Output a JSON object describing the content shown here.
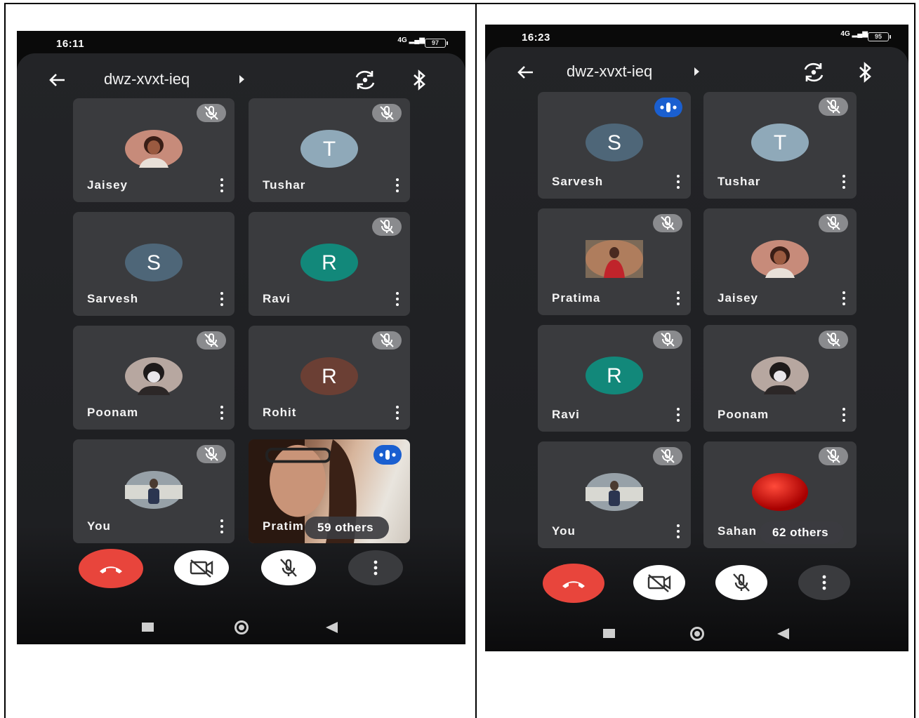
{
  "left_phone": {
    "status": {
      "time": "16:11",
      "network": "4G",
      "battery": "97"
    },
    "header": {
      "meeting_code": "dwz-xvxt-ieq"
    },
    "tiles": [
      {
        "name": "Jaisey",
        "initial": "",
        "avatar_color": "#c78b7a",
        "photo": "woman-avatar",
        "badge": "muted"
      },
      {
        "name": "Tushar",
        "initial": "T",
        "avatar_color": "#8fa9b9",
        "photo": "",
        "badge": "muted"
      },
      {
        "name": "Sarvesh",
        "initial": "S",
        "avatar_color": "#4e6678",
        "photo": "",
        "badge": "none"
      },
      {
        "name": "Ravi",
        "initial": "R",
        "avatar_color": "#12887a",
        "photo": "",
        "badge": "muted"
      },
      {
        "name": "Poonam",
        "initial": "",
        "avatar_color": "#b7a7a0",
        "photo": "masked-avatar",
        "badge": "muted"
      },
      {
        "name": "Rohit",
        "initial": "R",
        "avatar_color": "#6b3f34",
        "photo": "",
        "badge": "muted"
      },
      {
        "name": "You",
        "initial": "",
        "avatar_color": "#97a1a8",
        "photo": "man-avatar",
        "badge": "muted"
      },
      {
        "name": "Pratim",
        "initial": "",
        "avatar_color": "#7a5a45",
        "photo": "video-feed",
        "badge": "speaking",
        "others": "59 others"
      }
    ]
  },
  "right_phone": {
    "status": {
      "time": "16:23",
      "network": "4G",
      "battery": "95"
    },
    "header": {
      "meeting_code": "dwz-xvxt-ieq"
    },
    "tiles": [
      {
        "name": "Sarvesh",
        "initial": "S",
        "avatar_color": "#4e6678",
        "photo": "",
        "badge": "speaking"
      },
      {
        "name": "Tushar",
        "initial": "T",
        "avatar_color": "#8fa9b9",
        "photo": "",
        "badge": "muted"
      },
      {
        "name": "Pratima",
        "initial": "",
        "avatar_color": "#b86a4a",
        "photo": "woman-saree-avatar",
        "badge": "muted"
      },
      {
        "name": "Jaisey",
        "initial": "",
        "avatar_color": "#c78b7a",
        "photo": "woman-avatar",
        "badge": "muted"
      },
      {
        "name": "Ravi",
        "initial": "R",
        "avatar_color": "#12887a",
        "photo": "",
        "badge": "muted"
      },
      {
        "name": "Poonam",
        "initial": "",
        "avatar_color": "#b7a7a0",
        "photo": "masked-avatar",
        "badge": "muted"
      },
      {
        "name": "You",
        "initial": "",
        "avatar_color": "#97a1a8",
        "photo": "man-avatar",
        "badge": "muted"
      },
      {
        "name": "Sahan",
        "initial": "",
        "avatar_color": "#d00000",
        "photo": "red-ball-avatar",
        "badge": "muted",
        "others": "62 others"
      }
    ]
  },
  "controls": [
    {
      "name": "end-call-button",
      "icon": "phone-hangup-icon",
      "color": "#e8453c"
    },
    {
      "name": "camera-toggle-button",
      "icon": "camera-off-icon",
      "color": "#ffffff"
    },
    {
      "name": "mic-toggle-button",
      "icon": "mic-off-icon",
      "color": "#ffffff"
    },
    {
      "name": "more-options-button",
      "icon": "more-vertical-icon",
      "color": "#3a3b3e"
    }
  ]
}
